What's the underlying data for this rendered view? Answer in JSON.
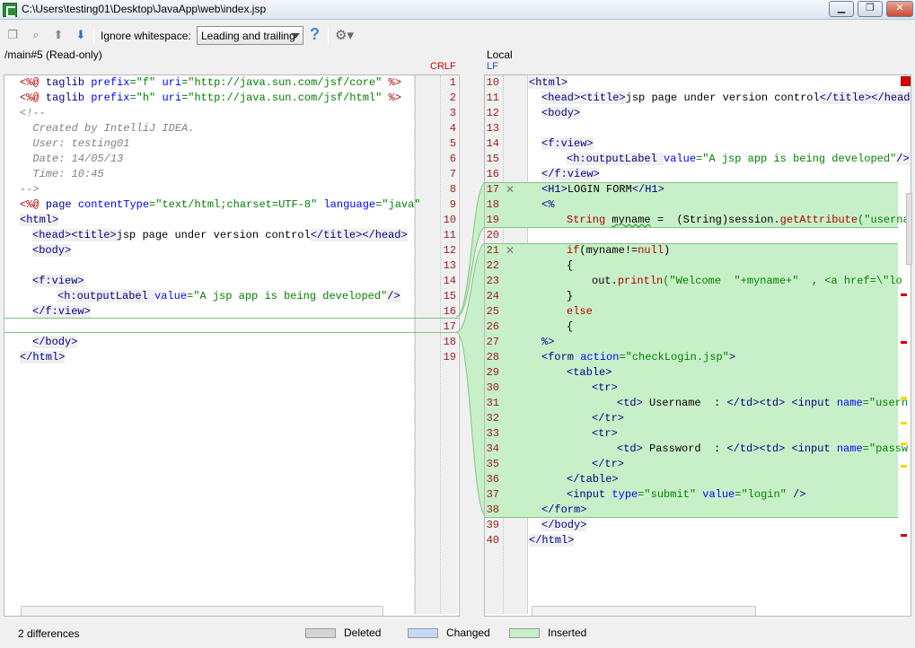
{
  "window": {
    "title": "C:\\Users\\testing01\\Desktop\\JavaApp\\web\\index.jsp",
    "minimize_label": "▁",
    "maximize_label": "❐",
    "close_label": "✕"
  },
  "toolbar": {
    "ignore_label": "Ignore whitespace:",
    "ignore_value": "Leading and trailing",
    "help_label": "?",
    "icons": [
      "copy-icon",
      "find-icon",
      "previous-diff-icon",
      "next-diff-icon",
      "settings-icon"
    ]
  },
  "left": {
    "title": "/main#5 (Read-only)",
    "line_sep": "CRLF"
  },
  "right": {
    "title": "Local",
    "line_sep": "LF"
  },
  "status": {
    "differences": "2 differences",
    "legend": [
      {
        "label": "Deleted",
        "color": "#d4d4d4"
      },
      {
        "label": "Changed",
        "color": "#c6d8f7"
      },
      {
        "label": "Inserted",
        "color": "#c8f0c8"
      }
    ]
  },
  "left_lines": [
    "1",
    "2",
    "3",
    "4",
    "5",
    "6",
    "7",
    "8",
    "9",
    "10",
    "11",
    "12",
    "13",
    "14",
    "15",
    "16",
    "17",
    "18",
    "19"
  ],
  "right_lines": [
    "10",
    "11",
    "12",
    "13",
    "14",
    "15",
    "16",
    "17",
    "18",
    "19",
    "20",
    "21",
    "22",
    "23",
    "24",
    "25",
    "26",
    "27",
    "28",
    "29",
    "30",
    "31",
    "32",
    "33",
    "34",
    "35",
    "36",
    "37",
    "38",
    "39",
    "40"
  ],
  "code_left": {
    "l1_a": "<%@ ",
    "l1_b": "taglib ",
    "l1_c": "prefix",
    "l1_d": "=\"f\" ",
    "l1_e": "uri",
    "l1_f": "=\"http://java.sun.com/jsf/core\" ",
    "l1_g": "%>",
    "l2_a": "<%@ ",
    "l2_b": "taglib ",
    "l2_c": "prefix",
    "l2_d": "=\"h\" ",
    "l2_e": "uri",
    "l2_f": "=\"http://java.sun.com/jsf/html\" ",
    "l2_g": "%>",
    "l3": "<!--",
    "l4": "  Created by IntelliJ IDEA.",
    "l5": "  User: testing01",
    "l6": "  Date: 14/05/13",
    "l7": "  Time: 10:45",
    "l8": "-->",
    "l9_a": "<%@ ",
    "l9_b": "page ",
    "l9_c": "contentType",
    "l9_d": "=\"text/html;charset=UTF-8\" ",
    "l9_e": "language",
    "l9_f": "=\"java\"",
    "l10": "<html>",
    "l11_a": "<head>",
    "l11_b": "<title>",
    "l11_c": "jsp page under version control",
    "l11_d": "</title>",
    "l11_e": "</head>",
    "l12": "<body>",
    "l14": "<f:view>",
    "l15_a": "<h:outputLabel ",
    "l15_b": "value",
    "l15_c": "=\"A jsp app is being developed\"",
    "l15_d": "/>",
    "l16": "</f:view>",
    "l18": "</body>",
    "l19": "</html>"
  },
  "code_right": {
    "r10": "<html>",
    "r11_a": "<head>",
    "r11_b": "<title>",
    "r11_c": "jsp page under version control",
    "r11_d": "</title>",
    "r11_e": "</head",
    "r12": "<body>",
    "r14": "<f:view>",
    "r15_a": "<h:outputLabel ",
    "r15_b": "value",
    "r15_c": "=\"A jsp app is being developed\"",
    "r15_d": "/>",
    "r16": "</f:view>",
    "r17_a": "<H1>",
    "r17_b": "LOGIN FORM",
    "r17_c": "</H1>",
    "r18": "<%",
    "r19_a": "String ",
    "r19_b": "myname",
    "r19_c": " =  (String)session.",
    "r19_d": "getAttribute",
    "r19_e": "(\"userna",
    "r21_a": "if",
    "r21_b": "(myname!=",
    "r21_c": "null",
    "r21_d": ")",
    "r22": "{",
    "r23_a": "out.",
    "r23_b": "println",
    "r23_c": "(\"Welcome  \"+myname+\"  , <a href=\\\"lo",
    "r24": "}",
    "r25": "else",
    "r26": "{",
    "r27": "%>",
    "r28_a": "<form ",
    "r28_b": "action",
    "r28_c": "=\"checkLogin.jsp\"",
    "r28_d": ">",
    "r29": "<table>",
    "r30": "<tr>",
    "r31_a": "<td>",
    "r31_b": " Username  : ",
    "r31_c": "</td><td>",
    "r31_d": " <input ",
    "r31_e": "name",
    "r31_f": "=\"usern",
    "r32": "</tr>",
    "r33": "<tr>",
    "r34_a": "<td>",
    "r34_b": " Password  : ",
    "r34_c": "</td><td>",
    "r34_d": " <input ",
    "r34_e": "name",
    "r34_f": "=\"passw",
    "r35": "</tr>",
    "r36": "</table>",
    "r37_a": "<input ",
    "r37_b": "type",
    "r37_c": "=\"submit\" ",
    "r37_d": "value",
    "r37_e": "=\"login\" ",
    "r37_f": "/>",
    "r38": "</form>",
    "r39": "</body>",
    "r40": "</html>"
  }
}
